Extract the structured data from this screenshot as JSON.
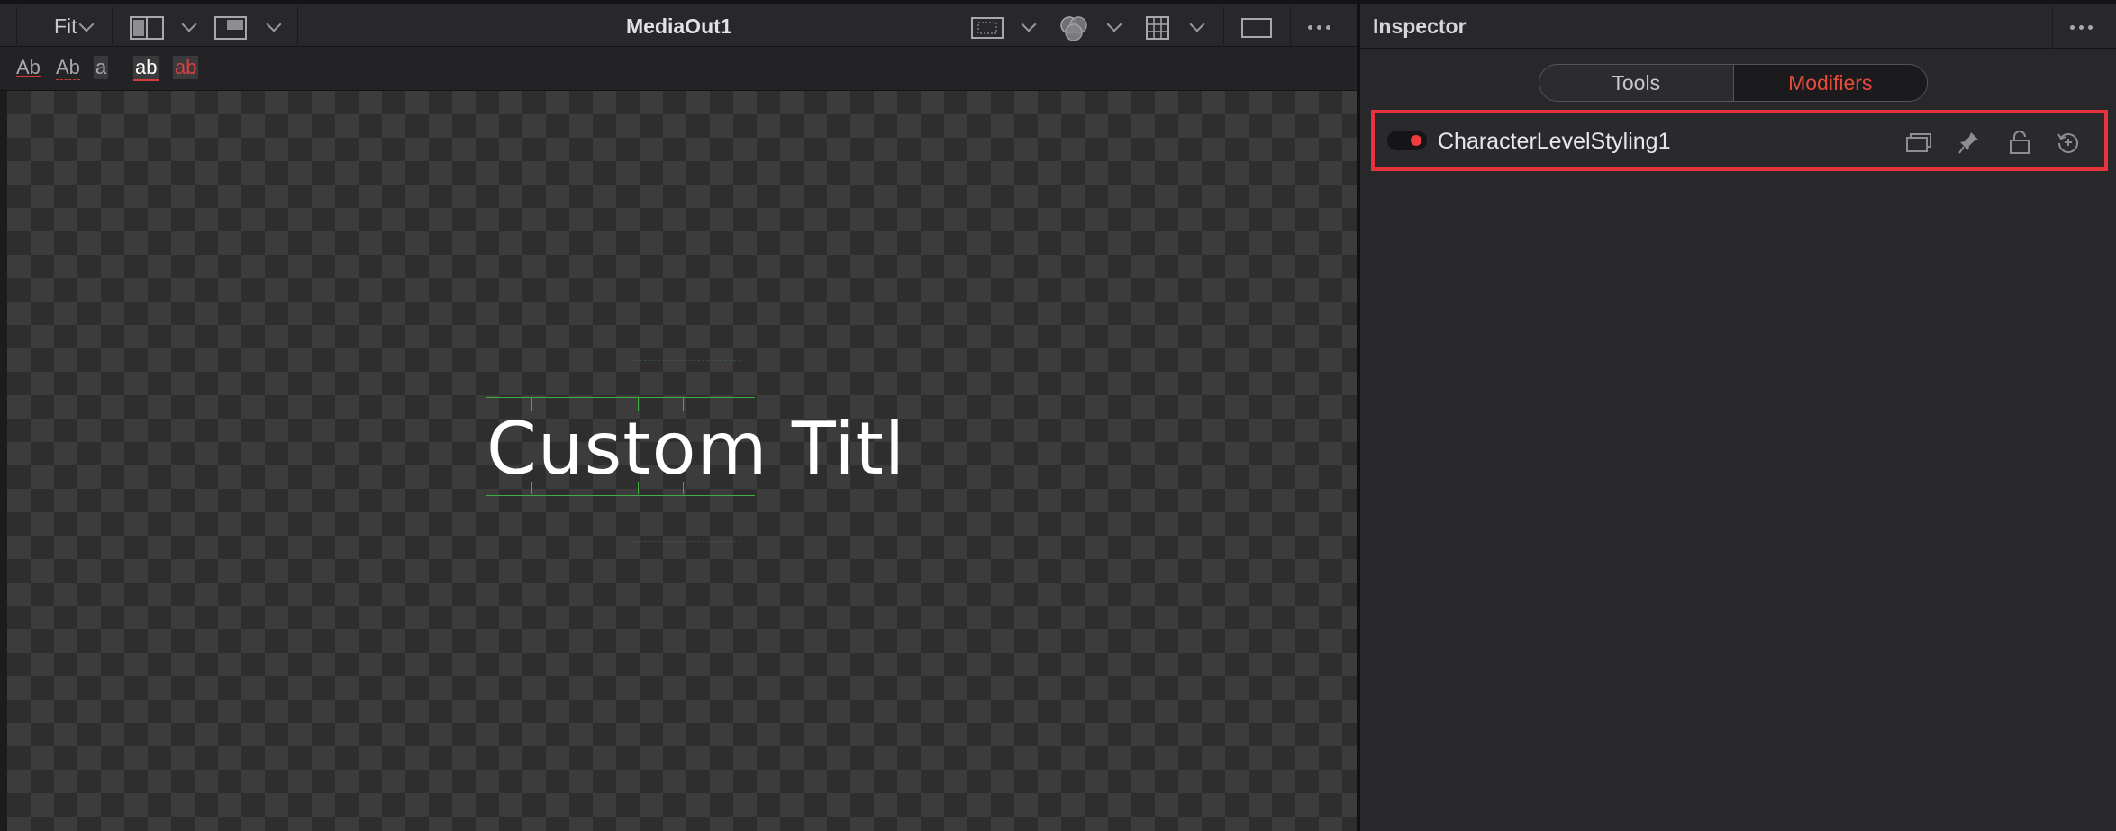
{
  "viewer": {
    "zoom_label": "Fit",
    "node_name": "MediaOut1",
    "text_tools": [
      "Ab",
      "Ab",
      "a",
      "ab",
      "ab"
    ],
    "canvas_text": "Custom Titl"
  },
  "inspector": {
    "title": "Inspector",
    "tabs": [
      {
        "label": "Tools",
        "active": false
      },
      {
        "label": "Modifiers",
        "active": true
      }
    ],
    "modifier": {
      "name": "CharacterLevelStyling1",
      "enabled": true
    }
  },
  "colors": {
    "accent_red": "#e64b3c",
    "highlight_border": "#e5343a",
    "bbox_green": "#3fb03f"
  },
  "icons": [
    "chevron-down-icon",
    "split-view-icon",
    "viewer-layout-icon",
    "roi-icon",
    "color-channels-icon",
    "grid-icon",
    "safe-frame-icon",
    "more-options-icon",
    "duplicate-icon",
    "pin-icon",
    "lock-icon",
    "reset-icon"
  ]
}
